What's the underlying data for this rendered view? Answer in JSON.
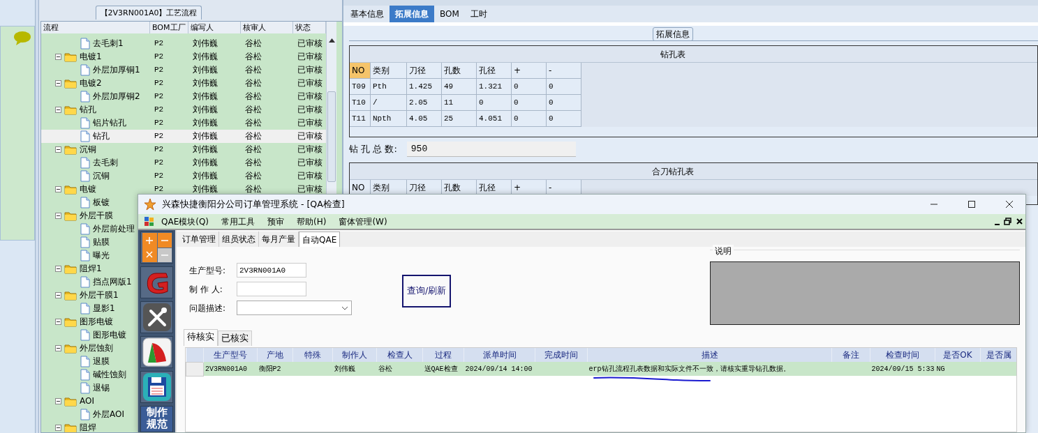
{
  "process_panel": {
    "title": "【2V3RN001A0】工艺流程",
    "columns": [
      "流程",
      "BOM工厂",
      "编写人",
      "核审人",
      "状态"
    ],
    "tree": [
      {
        "name": "去毛刺1",
        "kind": "file",
        "selected": false,
        "bom": "P2",
        "author": "刘伟巍",
        "reviewer": "谷松",
        "status": "已审核"
      },
      {
        "name": "电镀1",
        "kind": "folder",
        "selected": false,
        "bom": "P2",
        "author": "刘伟巍",
        "reviewer": "谷松",
        "status": "已审核",
        "children": [
          {
            "name": "外层加厚铜1",
            "kind": "file",
            "selected": false,
            "bom": "P2",
            "author": "刘伟巍",
            "reviewer": "谷松",
            "status": "已审核"
          }
        ]
      },
      {
        "name": "电镀2",
        "kind": "folder",
        "selected": false,
        "bom": "P2",
        "author": "刘伟巍",
        "reviewer": "谷松",
        "status": "已审核",
        "children": [
          {
            "name": "外层加厚铜2",
            "kind": "file",
            "selected": false,
            "bom": "P2",
            "author": "刘伟巍",
            "reviewer": "谷松",
            "status": "已审核"
          }
        ]
      },
      {
        "name": "钻孔",
        "kind": "folder",
        "selected": false,
        "bom": "P2",
        "author": "刘伟巍",
        "reviewer": "谷松",
        "status": "已审核",
        "children": [
          {
            "name": "铝片钻孔",
            "kind": "file",
            "selected": false,
            "bom": "P2",
            "author": "刘伟巍",
            "reviewer": "谷松",
            "status": "已审核"
          },
          {
            "name": "钻孔",
            "kind": "file",
            "selected": true,
            "bom": "P2",
            "author": "刘伟巍",
            "reviewer": "谷松",
            "status": "已审核"
          }
        ]
      },
      {
        "name": "沉铜",
        "kind": "folder",
        "selected": false,
        "bom": "P2",
        "author": "刘伟巍",
        "reviewer": "谷松",
        "status": "已审核",
        "children": [
          {
            "name": "去毛刺",
            "kind": "file",
            "selected": false,
            "bom": "P2",
            "author": "刘伟巍",
            "reviewer": "谷松",
            "status": "已审核"
          },
          {
            "name": "沉铜",
            "kind": "file",
            "selected": false,
            "bom": "P2",
            "author": "刘伟巍",
            "reviewer": "谷松",
            "status": "已审核"
          }
        ]
      },
      {
        "name": "电镀",
        "kind": "folder",
        "selected": false,
        "bom": "P2",
        "author": "刘伟巍",
        "reviewer": "谷松",
        "status": "已审核",
        "children": [
          {
            "name": "板镀",
            "kind": "file",
            "selected": false
          }
        ]
      },
      {
        "name": "外层干膜",
        "kind": "folder",
        "selected": false,
        "children": [
          {
            "name": "外层前处理",
            "kind": "file",
            "selected": false
          },
          {
            "name": "贴膜",
            "kind": "file",
            "selected": false
          },
          {
            "name": "曝光",
            "kind": "file",
            "selected": false
          }
        ]
      },
      {
        "name": "阻焊1",
        "kind": "folder",
        "selected": false,
        "children": [
          {
            "name": "挡点网版1",
            "kind": "file",
            "selected": false
          }
        ]
      },
      {
        "name": "外层干膜1",
        "kind": "folder",
        "selected": false,
        "children": [
          {
            "name": "显影1",
            "kind": "file",
            "selected": false
          }
        ]
      },
      {
        "name": "图形电镀",
        "kind": "folder",
        "selected": false,
        "children": [
          {
            "name": "图形电镀",
            "kind": "file",
            "selected": false
          }
        ]
      },
      {
        "name": "外层蚀刻",
        "kind": "folder",
        "selected": false,
        "children": [
          {
            "name": "退膜",
            "kind": "file",
            "selected": false
          },
          {
            "name": "碱性蚀刻",
            "kind": "file",
            "selected": false
          },
          {
            "name": "退锡",
            "kind": "file",
            "selected": false
          }
        ]
      },
      {
        "name": "AOI",
        "kind": "folder",
        "selected": false,
        "children": [
          {
            "name": "外层AOI",
            "kind": "file",
            "selected": false
          }
        ]
      },
      {
        "name": "阻焊",
        "kind": "folder",
        "selected": false
      }
    ]
  },
  "detail_panel": {
    "tabs": [
      {
        "label": "基本信息",
        "selected": false
      },
      {
        "label": "拓展信息",
        "selected": true
      },
      {
        "label": "BOM",
        "selected": false
      },
      {
        "label": "工时",
        "selected": false
      }
    ],
    "group_title": "拓展信息",
    "drill_table": {
      "title": "钻孔表",
      "columns": [
        {
          "label": "NO",
          "selected": true
        },
        {
          "label": "类别",
          "selected": false
        },
        {
          "label": "刀径",
          "selected": false
        },
        {
          "label": "孔数",
          "selected": false
        },
        {
          "label": "孔径",
          "selected": false
        },
        {
          "label": "+",
          "selected": false
        },
        {
          "label": "-",
          "selected": false
        }
      ],
      "rows": [
        [
          "T09",
          "Pth",
          "1.425",
          "49",
          "1.321",
          "0",
          "0"
        ],
        [
          "T10",
          "/",
          "2.05",
          "11",
          "0",
          "0",
          "0"
        ],
        [
          "T11",
          "Npth",
          "4.05",
          "25",
          "4.051",
          "0",
          "0"
        ]
      ]
    },
    "total_label": "钻 孔 总 数:",
    "total_value": "950",
    "combined_table": {
      "title": "合刀钻孔表",
      "columns": [
        {
          "label": "NO",
          "selected": false
        },
        {
          "label": "类别",
          "selected": false
        },
        {
          "label": "刀径",
          "selected": false
        },
        {
          "label": "孔数",
          "selected": false
        },
        {
          "label": "孔径",
          "selected": false
        },
        {
          "label": "+",
          "selected": false
        },
        {
          "label": "-",
          "selected": false
        }
      ]
    }
  },
  "dialog": {
    "title": "兴森快捷衡阳分公司订单管理系统 - [QA检查]",
    "menu": [
      "QAE模块(Q)",
      "常用工具",
      "预审",
      "帮助(H)",
      "窗体管理(W)"
    ],
    "toolbar": [
      {
        "kind": "calculator"
      },
      {
        "kind": "swirl"
      },
      {
        "kind": "tools"
      },
      {
        "kind": "chart"
      },
      {
        "kind": "save"
      },
      {
        "kind": "text",
        "label": "制作规范"
      }
    ],
    "tabs": [
      {
        "label": "订单管理",
        "selected": false
      },
      {
        "label": "组员状态",
        "selected": false
      },
      {
        "label": "每月产量",
        "selected": false
      },
      {
        "label": "自动QAE",
        "selected": true
      }
    ],
    "fields": [
      {
        "label": "生产型号:",
        "kind": "text",
        "value": "2V3RN001A0"
      },
      {
        "label": "制 作 人:",
        "kind": "text"
      },
      {
        "label": "问题描述:",
        "kind": "select"
      }
    ],
    "query_button": "查询/刷新",
    "note_title": "说明",
    "result_tabs": [
      {
        "label": "待核实",
        "selected": true
      },
      {
        "label": "已核实",
        "selected": false
      }
    ],
    "grid": {
      "columns": [
        "生产型号",
        "产地",
        "特殊",
        "制作人",
        "检查人",
        "过程",
        "派单时间",
        "完成时间",
        "描述",
        "备注",
        "检查时间",
        "是否OK",
        "是否属"
      ],
      "rows": [
        {
          "selected": false,
          "cells": [
            "2V3RN001A0",
            "衡阳P2",
            null,
            "刘伟巍",
            "谷松",
            "送QAE检查",
            "2024/09/14 14:00",
            null,
            "erp钻孔流程孔表数据和实际文件不一致，请核实重导钻孔数据。",
            null,
            "2024/09/15 5:33",
            "NG",
            null
          ]
        }
      ]
    }
  }
}
